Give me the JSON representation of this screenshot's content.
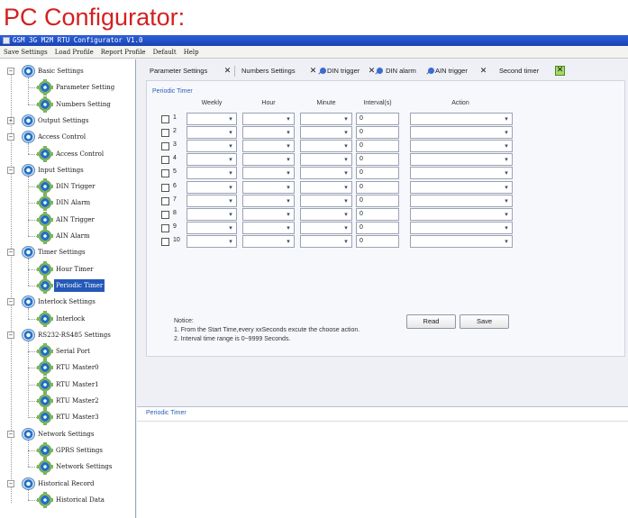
{
  "heading": "PC Configurator:",
  "window": {
    "title": "GSM 3G M2M RTU Configurator V1.0",
    "menu": [
      "Save Settings",
      "Load Profile",
      "Report Profile",
      "Default",
      "Help"
    ]
  },
  "sidebar": {
    "groups": [
      {
        "label": "Basic Settings",
        "children": [
          "Parameter Setting",
          "Numbers Setting"
        ]
      },
      {
        "label": "Output Settings",
        "children": []
      },
      {
        "label": "Access Control",
        "children": [
          "Access Control"
        ]
      },
      {
        "label": "Input Settings",
        "children": [
          "DIN Trigger",
          "DIN Alarm",
          "AIN Trigger",
          "AIN Alarm"
        ]
      },
      {
        "label": "Timer Settings",
        "children": [
          "Hour Timer",
          "Periodic Timer"
        ]
      },
      {
        "label": "Interlock Settings",
        "children": [
          "Interlock"
        ]
      },
      {
        "label": "RS232-RS485 Settings",
        "children": [
          "Serial Port",
          "RTU Master0",
          "RTU Master1",
          "RTU Master2",
          "RTU Master3"
        ]
      },
      {
        "label": "Network Settings",
        "children": [
          "GPRS Settings",
          "Network Settings"
        ]
      },
      {
        "label": "Historical Record",
        "children": [
          "Historical Data"
        ]
      }
    ],
    "selected": "Periodic Timer"
  },
  "tabs": [
    {
      "label": "Parameter Settings"
    },
    {
      "label": "Numbers Settings"
    },
    {
      "label": "DIN trigger"
    },
    {
      "label": "DIN alarm"
    },
    {
      "label": "AIN trigger"
    },
    {
      "label": "Second timer"
    }
  ],
  "panel": {
    "title": "Periodic Timer",
    "columns": {
      "weekly": "Weekly",
      "hour": "Hour",
      "minute": "Minute",
      "interval": "Interval(s)",
      "action": "Action"
    },
    "rows": [
      {
        "num": "1",
        "interval": "0"
      },
      {
        "num": "2",
        "interval": "0"
      },
      {
        "num": "3",
        "interval": "0"
      },
      {
        "num": "4",
        "interval": "0"
      },
      {
        "num": "5",
        "interval": "0"
      },
      {
        "num": "6",
        "interval": "0"
      },
      {
        "num": "7",
        "interval": "0"
      },
      {
        "num": "8",
        "interval": "0"
      },
      {
        "num": "9",
        "interval": "0"
      },
      {
        "num": "10",
        "interval": "0"
      }
    ],
    "notice": {
      "title": "Notice:",
      "line1": "1. From the Start Time,every xxSeconds excute the choose action.",
      "line2": "2. Interval time range is 0~9999 Seconds."
    },
    "read_label": "Read",
    "save_label": "Save"
  },
  "bottom_panel": {
    "title": "Periodic Timer"
  },
  "icons": {
    "tree_group": "settings-node-icon",
    "tree_leaf": "gear-icon",
    "tab_pin": "pin-icon",
    "tab_close": "close-icon",
    "combo_arrow": "chevron-down-icon"
  }
}
